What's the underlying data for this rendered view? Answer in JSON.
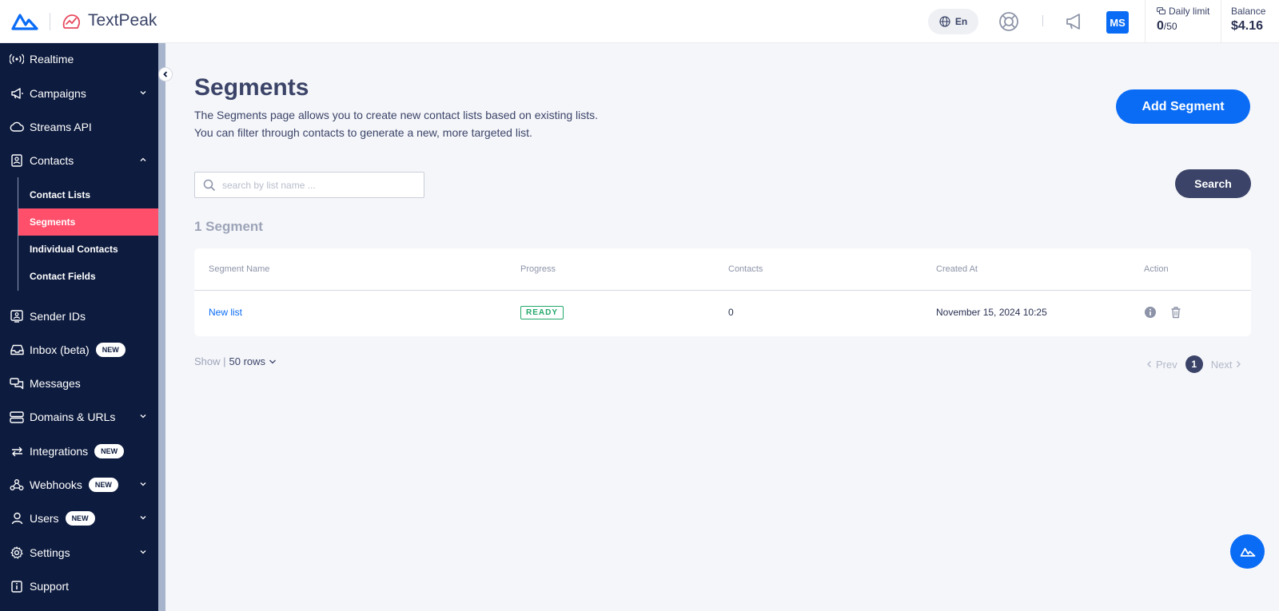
{
  "topbar": {
    "brand_name": "TextPeak",
    "language": "En",
    "avatar_initials": "MS",
    "daily_limit_label": "Daily limit",
    "daily_limit_used": "0",
    "daily_limit_total": "/50",
    "balance_label": "Balance",
    "balance_value": "$4.16"
  },
  "sidebar": {
    "items": [
      {
        "label": "Realtime",
        "icon": "realtime-icon"
      },
      {
        "label": "Campaigns",
        "icon": "megaphone-icon"
      },
      {
        "label": "Streams API",
        "icon": "cloud-icon"
      },
      {
        "label": "Contacts",
        "icon": "contacts-icon"
      },
      {
        "label": "Sender IDs",
        "icon": "sender-id-icon"
      },
      {
        "label": "Inbox (beta)",
        "icon": "inbox-icon",
        "badge": "NEW"
      },
      {
        "label": "Messages",
        "icon": "messages-icon"
      },
      {
        "label": "Domains & URLs",
        "icon": "server-icon"
      },
      {
        "label": "Integrations",
        "icon": "integrations-icon",
        "badge": "NEW"
      },
      {
        "label": "Webhooks",
        "icon": "webhook-icon",
        "badge": "NEW"
      },
      {
        "label": "Users",
        "icon": "user-icon",
        "badge": "NEW"
      },
      {
        "label": "Settings",
        "icon": "gear-icon"
      },
      {
        "label": "Support",
        "icon": "support-icon"
      }
    ],
    "contacts_sub": [
      "Contact Lists",
      "Segments",
      "Individual Contacts",
      "Contact Fields"
    ],
    "active_sub": "Segments"
  },
  "main": {
    "title": "Segments",
    "description_line1": "The Segments page allows you to create new contact lists based on existing lists.",
    "description_line2": "You can filter through contacts to generate a new, more targeted list.",
    "add_button": "Add Segment",
    "search_placeholder": "search by list name ...",
    "search_button": "Search",
    "count_title": "1 Segment"
  },
  "table": {
    "columns": [
      "Segment Name",
      "Progress",
      "Contacts",
      "Created At",
      "Action"
    ],
    "rows": [
      {
        "name": "New list",
        "progress": "READY",
        "contacts": "0",
        "created_at": "November 15, 2024 10:25"
      }
    ]
  },
  "footer": {
    "show_label": "Show |",
    "rows_value": "50 rows",
    "prev_label": "Prev",
    "current_page": "1",
    "next_label": "Next"
  },
  "colors": {
    "primary": "#0a6cf5",
    "sidebar_bg": "#0d1b3e",
    "active_item": "#ff4f6b",
    "ready_green": "#23a86b"
  }
}
